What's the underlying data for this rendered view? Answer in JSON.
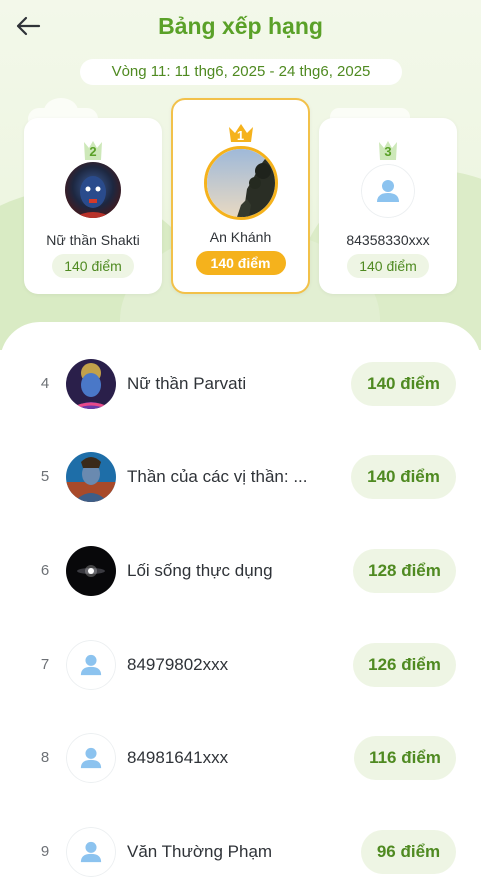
{
  "header": {
    "title": "Bảng xếp hạng",
    "back_icon": "arrow-left-icon"
  },
  "round": {
    "label": "Vòng 11: 11 thg6, 2025 - 24 thg6, 2025"
  },
  "podium": [
    {
      "rank": "2",
      "name": "Nữ thần Shakti",
      "score": "140 điểm",
      "avatar": "goddess-portrait-dark"
    },
    {
      "rank": "1",
      "name": "An Khánh",
      "score": "140 điểm",
      "avatar": "sky-tree-photo"
    },
    {
      "rank": "3",
      "name": "84358330xxx",
      "score": "140 điểm",
      "avatar": "default-user-icon"
    }
  ],
  "leaderboard": [
    {
      "rank": "4",
      "name": "Nữ thần Parvati",
      "score": "140 điểm",
      "avatar": "goddess-portrait-purple"
    },
    {
      "rank": "5",
      "name": "Thần của các vị thần: ...",
      "score": "140 điểm",
      "avatar": "deity-portrait-blue"
    },
    {
      "rank": "6",
      "name": "Lối sống thực dụng",
      "score": "128 điểm",
      "avatar": "dark-light-photo"
    },
    {
      "rank": "7",
      "name": "84979802xxx",
      "score": "126 điểm",
      "avatar": "default-user-icon"
    },
    {
      "rank": "8",
      "name": "84981641xxx",
      "score": "116 điểm",
      "avatar": "default-user-icon"
    },
    {
      "rank": "9",
      "name": "Văn Thường Phạm",
      "score": "96 điểm",
      "avatar": "default-user-icon"
    }
  ],
  "colors": {
    "brand_green": "#5aa128",
    "score_green": "#4f8a21",
    "gold": "#f5b21c",
    "user_icon_blue": "#8cc3ef"
  }
}
